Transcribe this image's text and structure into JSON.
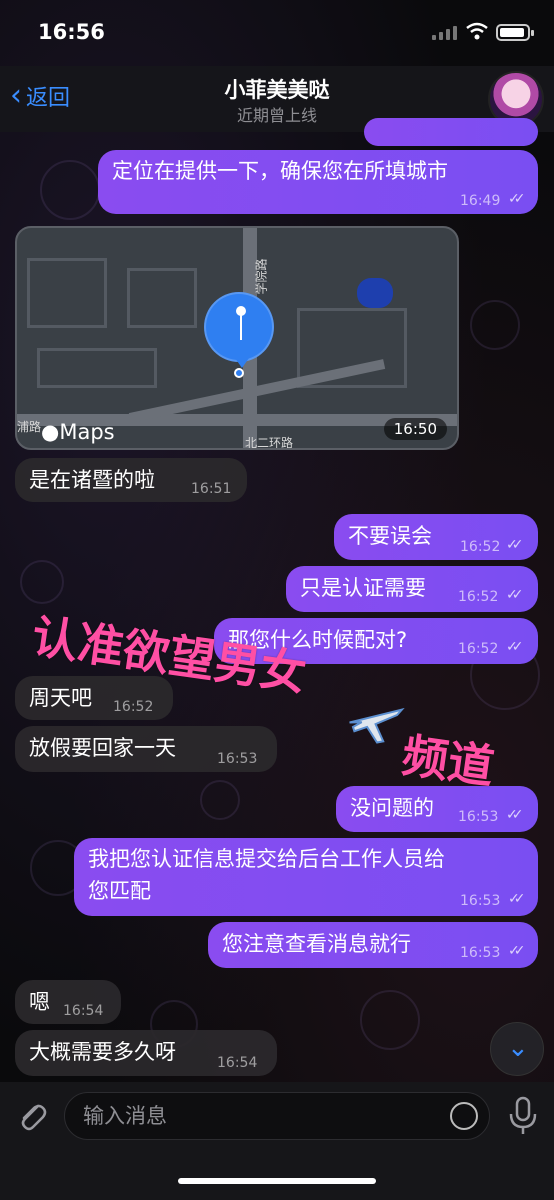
{
  "status_bar": {
    "time": "16:56"
  },
  "header": {
    "back_label": "返回",
    "title": "小菲美美哒",
    "subtitle": "近期曾上线"
  },
  "messages": [
    {
      "dir": "out",
      "text": "定位在提供一下，确保您在所填城市",
      "time": "16:49"
    },
    {
      "dir": "in",
      "text": "是在诸暨的啦",
      "time": "16:51"
    },
    {
      "dir": "out",
      "text": "不要误会",
      "time": "16:52"
    },
    {
      "dir": "out",
      "text": "只是认证需要",
      "time": "16:52"
    },
    {
      "dir": "out",
      "text": "那您什么时候配对?",
      "time": "16:52"
    },
    {
      "dir": "in",
      "text": "周天吧",
      "time": "16:52"
    },
    {
      "dir": "in",
      "text": "放假要回家一天",
      "time": "16:53"
    },
    {
      "dir": "out",
      "text": "没问题的",
      "time": "16:53"
    },
    {
      "dir": "out",
      "text_line1": "我把您认证信息提交给后台工作人员给",
      "text_line2": "您匹配",
      "time": "16:53"
    },
    {
      "dir": "out",
      "text": "您注意查看消息就行",
      "time": "16:53"
    },
    {
      "dir": "in",
      "text": "嗯",
      "time": "16:54"
    },
    {
      "dir": "in",
      "text": "大概需要多久呀",
      "time": "16:54"
    }
  ],
  "map": {
    "brand": "Maps",
    "time": "16:50",
    "street_labels": [
      "学院路",
      "北二环路",
      "浦路"
    ]
  },
  "overlay": {
    "line1": "认准欲望男女",
    "line2": "频道"
  },
  "input": {
    "placeholder": "输入消息"
  },
  "colors": {
    "accent": "#3a8dff",
    "outgoing": "#8a4cf0",
    "overlay": "#ff4fa4"
  }
}
